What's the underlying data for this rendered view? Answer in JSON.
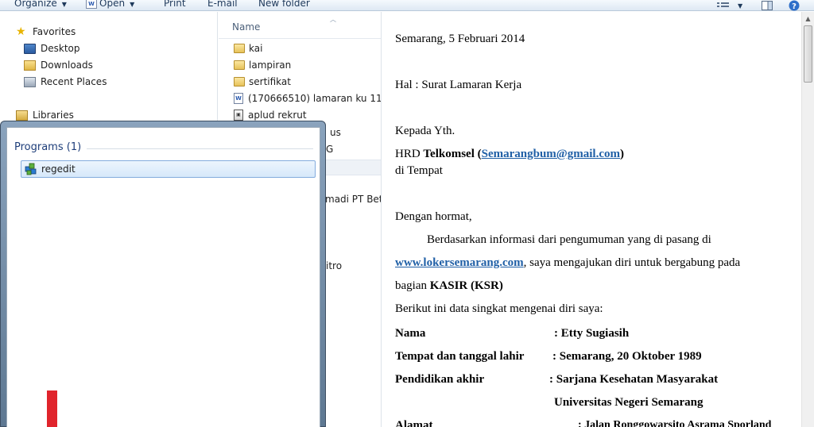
{
  "toolbar": {
    "organize": "Organize",
    "open": "Open",
    "print": "Print",
    "email": "E-mail",
    "new_folder": "New folder"
  },
  "nav": {
    "favorites": "Favorites",
    "desktop": "Desktop",
    "downloads": "Downloads",
    "recent_places": "Recent Places",
    "libraries": "Libraries"
  },
  "files": {
    "column_name": "Name",
    "items": [
      {
        "name": "kai",
        "type": "folder"
      },
      {
        "name": "lampiran",
        "type": "folder"
      },
      {
        "name": "sertifikat",
        "type": "folder"
      },
      {
        "name": "(170666510) lamaran ku 11",
        "type": "word"
      },
      {
        "name": "aplud rekrut",
        "type": "image"
      }
    ],
    "partial_1": "us",
    "partial_2": "G",
    "partial_3": "madi PT Beto",
    "partial_4": "itro"
  },
  "start_menu": {
    "programs_header": "Programs (1)",
    "result": "regedit"
  },
  "document": {
    "date_line": "Semarang,  5 Februari 2014",
    "subject": "Hal : Surat Lamaran Kerja",
    "to": "Kepada Yth.",
    "hrd_prefix": "HRD  ",
    "hrd_company": "Telkomsel (",
    "hrd_email": "Semarangbum@gmail.com",
    "hrd_close": ")",
    "place": "di Tempat",
    "greeting": "Dengan hormat,",
    "para_1": "Berdasarkan informasi dari pengumuman yang di pasang di",
    "para_link": "www.lokersemarang.com",
    "para_2": ", saya mengajukan diri untuk bergabung pada",
    "para_3_prefix": "bagian  ",
    "para_3_position": "KASIR (KSR)",
    "data_intro": "Berikut ini data singkat mengenai diri saya:",
    "fields": [
      {
        "label": "Nama",
        "value": ": Etty Sugiasih"
      },
      {
        "label": "Tempat dan tanggal lahir",
        "value": ": Semarang, 20 Oktober 1989"
      },
      {
        "label": "Pendidikan akhir",
        "value": ": Sarjana Kesehatan Masyarakat"
      },
      {
        "label": "",
        "value": "Universitas Negeri Semarang"
      },
      {
        "label": "Alamat",
        "value": ": Jalan Ronggowarsito Asrama Sporland"
      }
    ]
  }
}
